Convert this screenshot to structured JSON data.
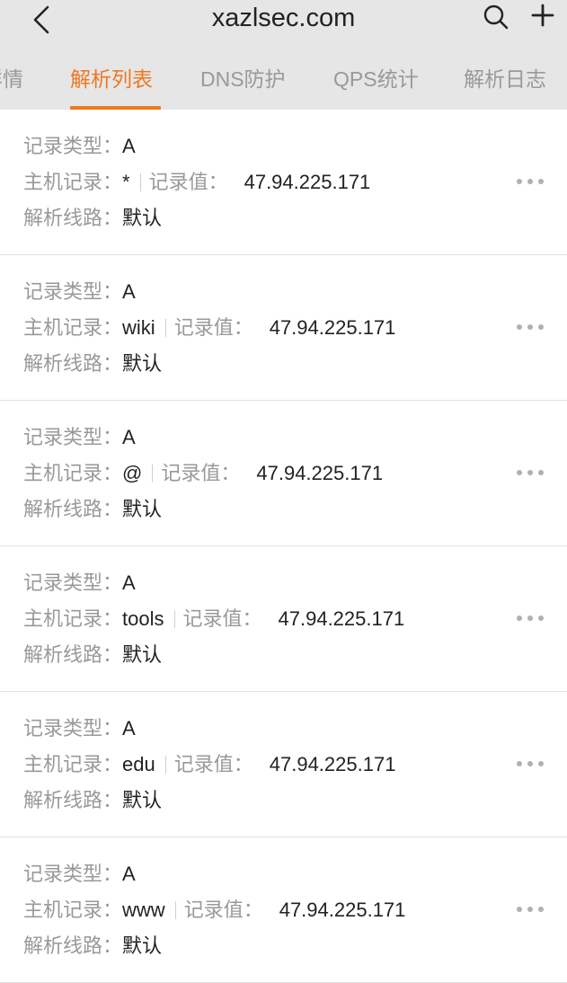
{
  "header": {
    "title": "xazlsec.com"
  },
  "tabs": [
    {
      "label": "详情"
    },
    {
      "label": "解析列表"
    },
    {
      "label": "DNS防护"
    },
    {
      "label": "QPS统计"
    },
    {
      "label": "解析日志"
    }
  ],
  "labels": {
    "type": "记录类型：",
    "host": "主机记录：",
    "value": "记录值：",
    "line": "解析线路："
  },
  "records": [
    {
      "type": "A",
      "host": "*",
      "value": "47.94.225.171",
      "line": "默认"
    },
    {
      "type": "A",
      "host": "wiki",
      "value": "47.94.225.171",
      "line": "默认"
    },
    {
      "type": "A",
      "host": "@",
      "value": "47.94.225.171",
      "line": "默认"
    },
    {
      "type": "A",
      "host": "tools",
      "value": "47.94.225.171",
      "line": "默认"
    },
    {
      "type": "A",
      "host": "edu",
      "value": "47.94.225.171",
      "line": "默认"
    },
    {
      "type": "A",
      "host": "www",
      "value": "47.94.225.171",
      "line": "默认"
    }
  ],
  "colors": {
    "accent": "#f07822",
    "header_bg": "#e6e6e6",
    "label": "#999999",
    "text": "#222222"
  }
}
